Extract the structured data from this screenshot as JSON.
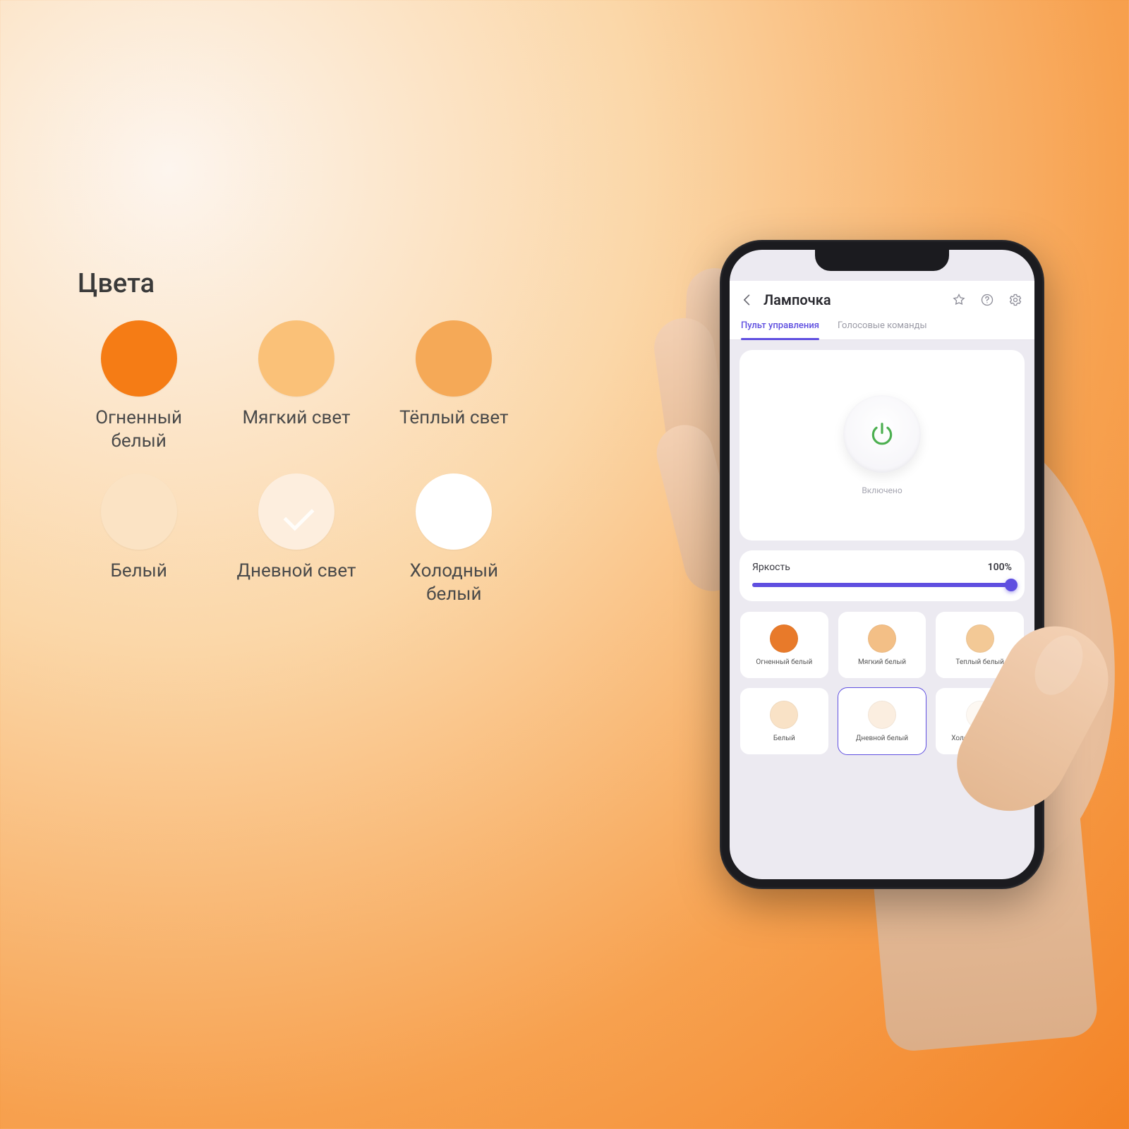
{
  "palette": {
    "title": "Цвета",
    "swatches": [
      {
        "label": "Огненный белый",
        "color": "#f57c15",
        "checked": false
      },
      {
        "label": "Мягкий свет",
        "color": "#fac178",
        "checked": false
      },
      {
        "label": "Тёплый свет",
        "color": "#f5a957",
        "checked": false
      },
      {
        "label": "Белый",
        "color": "#fbe3c4",
        "checked": false
      },
      {
        "label": "Дневной свет",
        "color": "#fdeede",
        "checked": true
      },
      {
        "label": "Холодный белый",
        "color": "#ffffff",
        "checked": false
      }
    ]
  },
  "app": {
    "title": "Лампочка",
    "tabs": {
      "active": "Пульт управления",
      "inactive": "Голосовые команды"
    },
    "power_status": "Включено",
    "brightness": {
      "label": "Яркость",
      "value": "100%",
      "percent": 100
    },
    "presets": [
      {
        "label": "Огненный белый",
        "color": "#e87a2a",
        "selected": false
      },
      {
        "label": "Мягкий белый",
        "color": "#f3bf86",
        "selected": false
      },
      {
        "label": "Теплый белый",
        "color": "#f3c996",
        "selected": false
      },
      {
        "label": "Белый",
        "color": "#f9e2c6",
        "selected": false
      },
      {
        "label": "Дневной белый",
        "color": "#fbeee0",
        "selected": true
      },
      {
        "label": "Холодный белый",
        "color": "#fdf8f2",
        "selected": false
      }
    ]
  },
  "colors": {
    "accent": "#5f4fe0",
    "power_on": "#4caf50"
  }
}
